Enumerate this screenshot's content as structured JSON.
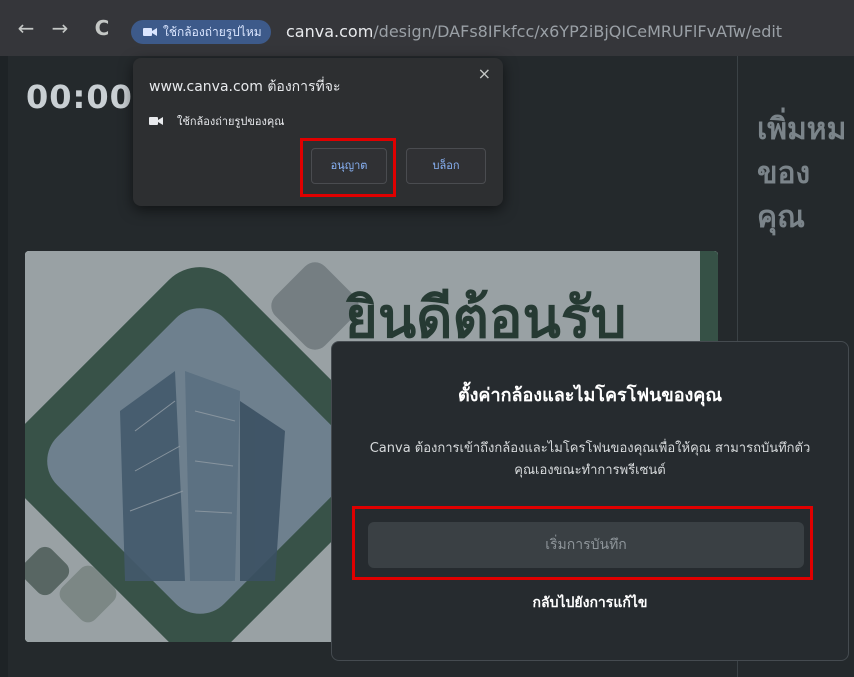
{
  "browser": {
    "back": "←",
    "forward": "→",
    "reload": "C",
    "camera_chip": "ใช้กล้องถ่ายรูปไหม",
    "url_domain": "canva.com",
    "url_path": "/design/DAFs8IFkfcc/x6YP2iBjQICeMRUFlFvATw/edit"
  },
  "permission_popup": {
    "title": "www.canva.com ต้องการที่จะ",
    "close": "×",
    "item": "ใช้กล้องถ่ายรูปของคุณ",
    "allow": "อนุญาต",
    "block": "บล็อก"
  },
  "editor": {
    "timer": "00:00",
    "side_title": "เพิ่มหม\nของคุณ",
    "slide_title": "ยินดีต้อนรับ"
  },
  "modal": {
    "title": "ตั้งค่ากล้องและไมโครโฟนของคุณ",
    "body": "Canva ต้องการเข้าถึงกล้องและไมโครโฟนของคุณเพื่อให้คุณ สามารถบันทึกตัวคุณเองขณะทำการพรีเซนต์",
    "record_button": "เริ่มการบันทึก",
    "back_link": "กลับไปยังการแก้ไข"
  },
  "colors": {
    "highlight": "#e00000",
    "link_blue": "#8ab4f8",
    "slide_green": "#2f4b3d"
  }
}
